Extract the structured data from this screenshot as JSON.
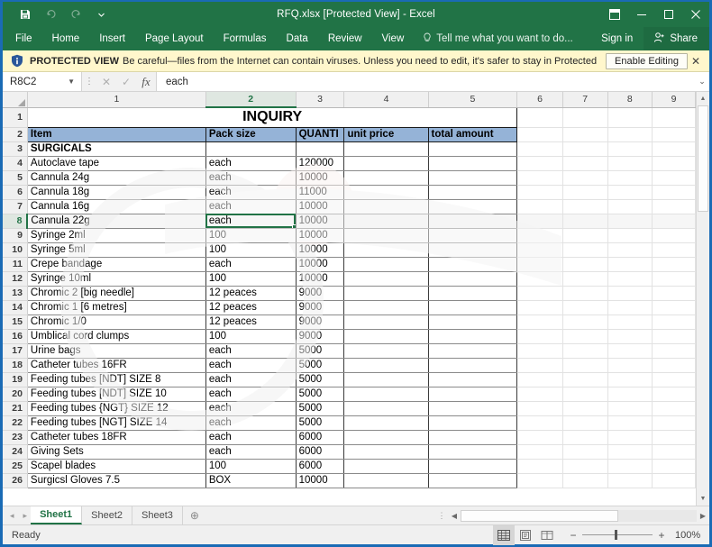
{
  "window": {
    "title": "RFQ.xlsx  [Protected View] - Excel",
    "qat": [
      {
        "name": "save-icon",
        "label": "Save"
      },
      {
        "name": "undo-icon",
        "label": "Undo"
      },
      {
        "name": "redo-icon",
        "label": "Redo"
      },
      {
        "name": "customize-qat-icon",
        "label": "Customize Quick Access Toolbar"
      }
    ],
    "controls": [
      {
        "name": "ribbon-display-options-button",
        "glyph": "⬒"
      },
      {
        "name": "minimize-button",
        "glyph": "─"
      },
      {
        "name": "maximize-button",
        "glyph": "☐"
      },
      {
        "name": "close-button",
        "glyph": "✕"
      }
    ],
    "accent_green": "#217346",
    "border_blue": "#1a6bb5"
  },
  "ribbon": {
    "tabs": [
      "File",
      "Home",
      "Insert",
      "Page Layout",
      "Formulas",
      "Data",
      "Review",
      "View"
    ],
    "tellme": "Tell me what you want to do...",
    "signin": "Sign in",
    "share": "Share"
  },
  "protected_view": {
    "label": "PROTECTED VIEW",
    "message": "Be careful—files from the Internet can contain viruses. Unless you need to edit, it's safer to stay in Protected View.",
    "enable_button": "Enable Editing",
    "close": "✕",
    "background": "#fff7cc"
  },
  "formula_bar": {
    "name_box": "R8C2",
    "cancel": "✕",
    "enter": "✓",
    "fx": "fx",
    "value": "each",
    "expand": "⌄"
  },
  "grid": {
    "column_headers": [
      "1",
      "2",
      "3",
      "4",
      "5",
      "6",
      "7",
      "8",
      "9"
    ],
    "selected_column": "2",
    "selected_row": "8",
    "selected_cell_value": "each",
    "row_numbers": [
      "1",
      "2",
      "3",
      "4",
      "5",
      "6",
      "7",
      "8",
      "9",
      "10",
      "11",
      "12",
      "13",
      "14",
      "15",
      "16",
      "17",
      "18",
      "19",
      "20",
      "21",
      "22",
      "23",
      "24",
      "25",
      "26"
    ],
    "title": "INQUIRY",
    "header_row": [
      "Item",
      "Pack size",
      "QUANTITY",
      "unit price",
      "total amount"
    ],
    "header_row_display": [
      "Item",
      "Pack size",
      "QUANTI",
      "unit price",
      "total amount"
    ],
    "header_fill": "#95b3d7",
    "section": "SURGICALS",
    "rows": [
      {
        "item": "Autoclave tape",
        "pack": "each",
        "qty": "120000",
        "unit": "",
        "total": ""
      },
      {
        "item": "Cannula 24g",
        "pack": "each",
        "qty": "10000",
        "unit": "",
        "total": ""
      },
      {
        "item": "Cannula 18g",
        "pack": "each",
        "qty": "11000",
        "unit": "",
        "total": ""
      },
      {
        "item": "Cannula 16g",
        "pack": "each",
        "qty": "10000",
        "unit": "",
        "total": ""
      },
      {
        "item": "Cannula 22g",
        "pack": "each",
        "qty": "10000",
        "unit": "",
        "total": ""
      },
      {
        "item": "Syringe 2ml",
        "pack": "100",
        "qty": "10000",
        "unit": "",
        "total": ""
      },
      {
        "item": "Syringe 5ml",
        "pack": "100",
        "qty": "10000",
        "unit": "",
        "total": ""
      },
      {
        "item": "Crepe bandage",
        "pack": "each",
        "qty": "10000",
        "unit": "",
        "total": ""
      },
      {
        "item": "Syringe 10ml",
        "pack": "100",
        "qty": "10000",
        "unit": "",
        "total": ""
      },
      {
        "item": "Chromic 2 [big needle]",
        "pack": "12 peaces",
        "qty": "9000",
        "unit": "",
        "total": ""
      },
      {
        "item": "Chromic 1 [6 metres]",
        "pack": "12 peaces",
        "qty": "9000",
        "unit": "",
        "total": ""
      },
      {
        "item": "Chromic 1/0",
        "pack": "12 peaces",
        "qty": "9000",
        "unit": "",
        "total": ""
      },
      {
        "item": "Umblical cord clumps",
        "pack": "100",
        "qty": "9000",
        "unit": "",
        "total": ""
      },
      {
        "item": "Urine bags",
        "pack": "each",
        "qty": "5000",
        "unit": "",
        "total": ""
      },
      {
        "item": "Catheter tubes 16FR",
        "pack": "each",
        "qty": "5000",
        "unit": "",
        "total": ""
      },
      {
        "item": "Feeding tubes [NDT] SIZE   8",
        "pack": "each",
        "qty": "5000",
        "unit": "",
        "total": ""
      },
      {
        "item": "Feeding tubes [NDT] SIZE    10",
        "pack": "each",
        "qty": "5000",
        "unit": "",
        "total": ""
      },
      {
        "item": "Feeding tubes {NGT}  SIZE 12",
        "pack": "each",
        "qty": "5000",
        "unit": "",
        "total": ""
      },
      {
        "item": "Feeding tubes [NGT] SIZE 14",
        "pack": "each",
        "qty": "5000",
        "unit": "",
        "total": ""
      },
      {
        "item": "Catheter tubes 18FR",
        "pack": "each",
        "qty": "6000",
        "unit": "",
        "total": ""
      },
      {
        "item": "Giving Sets",
        "pack": "each",
        "qty": "6000",
        "unit": "",
        "total": ""
      },
      {
        "item": "Scapel blades",
        "pack": "100",
        "qty": "6000",
        "unit": "",
        "total": ""
      },
      {
        "item": "Surgicsl Gloves 7.5",
        "pack": "BOX",
        "qty": "10000",
        "unit": "",
        "total": ""
      }
    ]
  },
  "sheet_tabs": {
    "prev": "◂",
    "next": "▸",
    "tabs": [
      "Sheet1",
      "Sheet2",
      "Sheet3"
    ],
    "active": "Sheet1",
    "add": "⊕"
  },
  "status_bar": {
    "text": "Ready",
    "views": [
      {
        "name": "normal-view-button",
        "active": true
      },
      {
        "name": "page-layout-view-button",
        "active": false
      },
      {
        "name": "page-break-preview-button",
        "active": false
      }
    ],
    "zoom_out": "−",
    "zoom_in": "+",
    "zoom_level": "100%"
  }
}
